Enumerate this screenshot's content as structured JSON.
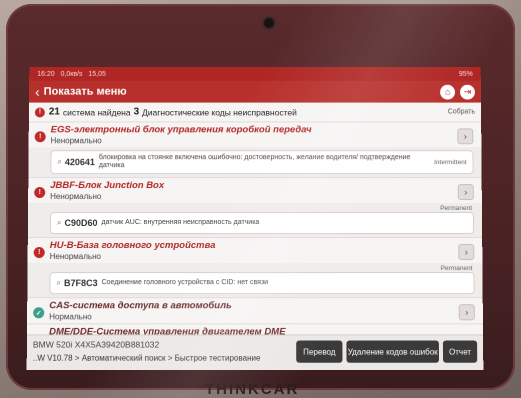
{
  "statusbar": {
    "time": "16:20",
    "speed": "0,0кв/s",
    "clock2": "15,05",
    "battery": "95%"
  },
  "header": {
    "back_glyph": "‹",
    "title": "Показать меню"
  },
  "summary": {
    "count": "21",
    "text_a": "система найдена",
    "dtc_count": "3",
    "text_b": "Диагностические коды неисправностей",
    "collapse_label": "Собрать"
  },
  "systems": [
    {
      "name": "EGS-электронный блок управления коробкой передач",
      "status": "Ненормально",
      "dtc": {
        "code": "420641",
        "desc": "блокировка на стоянке включена ошибочно: достоверность, желание водителя/ подтверждение датчика",
        "tag": "Intermittent"
      }
    },
    {
      "name": "JBBF-Блок Junction Box",
      "status": "Ненормально",
      "dtc": {
        "code": "C90D60",
        "desc": "датчик AUC: внутренняя неисправность датчика",
        "tag": "Permanent"
      }
    },
    {
      "name": "HU-B-База головного устройства",
      "status": "Ненормально",
      "dtc": {
        "code": "B7F8C3",
        "desc": "Соединение головного устройства с CID: нет связи",
        "tag": "Permanent"
      }
    },
    {
      "name": "CAS-система доступа в автомобиль",
      "status": "Нормально"
    },
    {
      "name": "DME/DDE-Система управления двигателем DME",
      "status": ""
    }
  ],
  "bottom": {
    "vin": "BMW  520i  X4X5A39420B881032",
    "path": "..W V10.78 > Автоматический поиск  > Быстрое тестирование",
    "translate_btn": "Перевод",
    "clear_btn": "Удаление кодов ошибок",
    "report_btn": "Отчет"
  },
  "device": {
    "brand": "THINKCAR"
  },
  "colors": {
    "header": "#b8302c",
    "error_icon": "#c0282a",
    "ok_icon": "#3aa08a"
  }
}
